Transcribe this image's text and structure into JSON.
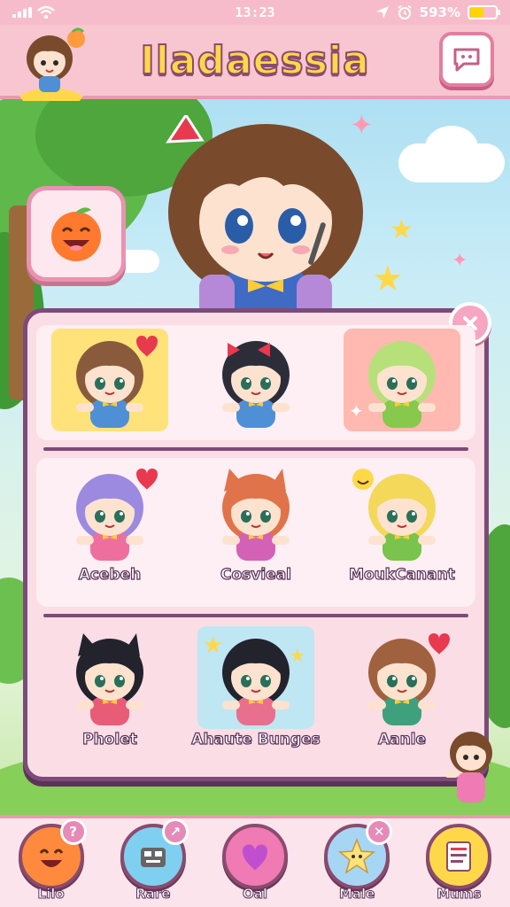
{
  "status_bar": {
    "time": "13:23",
    "battery_percent": "593%",
    "battery_level": 0.55,
    "icons": [
      "signal-icon",
      "wifi-icon",
      "location-icon",
      "alarm-icon",
      "battery-icon"
    ]
  },
  "header": {
    "title": "Iladaessia",
    "avatar": "avatar",
    "chat_icon": "chat-bubble-icon"
  },
  "hero": {
    "emoji_button_icon": "laughing-orange-icon"
  },
  "panel": {
    "close_icon": "close-icon",
    "rows": [
      {
        "characters": [
          {
            "name": "",
            "hair": "#8a5a3c",
            "outfit": "#4f8fd6",
            "tile": "#ffe27a",
            "accessory": "heart-icon"
          },
          {
            "name": "",
            "hair": "#2d2d3a",
            "outfit": "#4f8fd6",
            "tile": "#fdeff3",
            "accessory": "bow-icon"
          },
          {
            "name": "",
            "hair": "#b7e07a",
            "outfit": "#86c94c",
            "tile": "#ffb9b0",
            "accessory": "sparkle-icon"
          }
        ]
      },
      {
        "characters": [
          {
            "name": "Acebeh",
            "hair": "#9c8ae0",
            "outfit": "#ee6f9e",
            "tile": "#fdeff3",
            "accessory": "heart-icon"
          },
          {
            "name": "Cosvieal",
            "hair": "#e0734a",
            "outfit": "#d362b6",
            "tile": "#fdeff3",
            "accessory": "cat-ears-icon"
          },
          {
            "name": "MoukCanant",
            "hair": "#f3d85a",
            "outfit": "#7ac34c",
            "tile": "#fdeff3",
            "accessory": "smiley-icon"
          }
        ]
      },
      {
        "characters": [
          {
            "name": "Pholet",
            "hair": "#23232e",
            "outfit": "#e85c78",
            "tile": "#fbdde6",
            "accessory": "cat-ears-icon"
          },
          {
            "name": "Ahaute Bunges",
            "hair": "#23232e",
            "outfit": "#e8708e",
            "tile": "#bfe6f3",
            "accessory": "star-icon"
          },
          {
            "name": "Aanle",
            "hair": "#a0613e",
            "outfit": "#3fa07e",
            "tile": "#fbdde6",
            "accessory": "heart-icon"
          }
        ]
      }
    ]
  },
  "bottom_nav": [
    {
      "label": "Lilo",
      "icon": "laughing-face-icon",
      "badge": "?",
      "color": "#ff8a3d"
    },
    {
      "label": "Rare",
      "icon": "robot-icon",
      "badge": "↗",
      "color": "#7fd0f0"
    },
    {
      "label": "Oal",
      "icon": "heart-icon",
      "badge": "",
      "color": "#f07ab4"
    },
    {
      "label": "Male",
      "icon": "star-face-icon",
      "badge": "✕",
      "color": "#a7d6f5"
    },
    {
      "label": "Mums",
      "icon": "notes-icon",
      "badge": "",
      "color": "#ffd84a"
    }
  ]
}
